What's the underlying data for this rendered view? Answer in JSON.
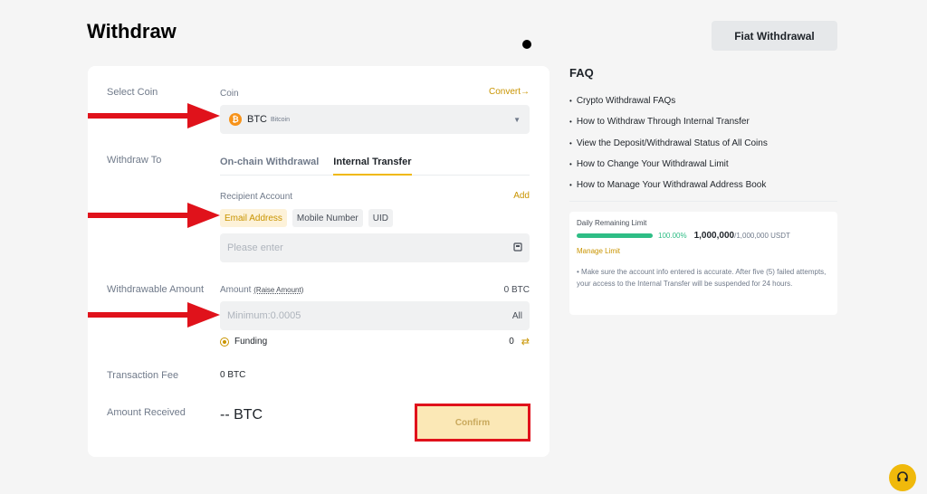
{
  "header": {
    "title": "Withdraw",
    "fiat_button": "Fiat Withdrawal"
  },
  "form": {
    "select_coin_label": "Select Coin",
    "coin_label": "Coin",
    "convert_link": "Convert",
    "coin_symbol": "BTC",
    "coin_name": "Bitcoin",
    "coin_icon_glyph": "₿",
    "withdraw_to_label": "Withdraw To",
    "tabs": [
      {
        "label": "On-chain Withdrawal",
        "active": false
      },
      {
        "label": "Internal Transfer",
        "active": true
      }
    ],
    "recipient_label": "Recipient Account",
    "add_link": "Add",
    "recipient_types": [
      {
        "label": "Email Address",
        "active": true
      },
      {
        "label": "Mobile Number",
        "active": false
      },
      {
        "label": "UID",
        "active": false
      }
    ],
    "recipient_placeholder": "Please enter",
    "withdrawable_label": "Withdrawable Amount",
    "amount_label": "Amount",
    "raise_amount_link": "(Raise Amount)",
    "amount_balance": "0 BTC",
    "amount_placeholder": "Minimum:0.0005",
    "all_button": "All",
    "funding_label": "Funding",
    "funding_value": "0",
    "fee_label": "Transaction Fee",
    "fee_value": "0 BTC",
    "received_label": "Amount Received",
    "received_value": "-- BTC",
    "confirm_button": "Confirm"
  },
  "faq": {
    "title": "FAQ",
    "items": [
      "Crypto Withdrawal FAQs",
      "How to Withdraw Through Internal Transfer",
      "View the Deposit/Withdrawal Status of All Coins",
      "How to Change Your Withdrawal Limit",
      "How to Manage Your Withdrawal Address Book"
    ]
  },
  "limit": {
    "label": "Daily Remaining Limit",
    "progress": 1.0,
    "percent_text": "100.00%",
    "value": "1,000,000",
    "total": "/1,000,000 USDT",
    "manage_link": "Manage Limit",
    "note": "• Make sure the account info entered is accurate. After five (5) failed attempts, your access to the Internal Transfer will be suspended for 24 hours."
  },
  "colors": {
    "accent": "#f0b90b",
    "accent_text": "#c99400",
    "success": "#2ebd85",
    "annotation_red": "#e0121b"
  }
}
